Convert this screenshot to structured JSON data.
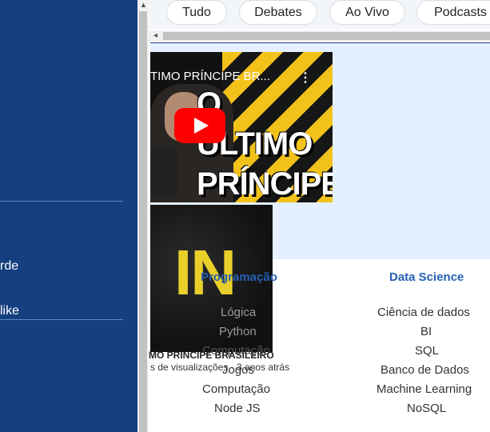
{
  "sidebar": {
    "items": [
      {
        "label": "rde"
      },
      {
        "label": "like"
      }
    ]
  },
  "chips": [
    {
      "label": "Tudo"
    },
    {
      "label": "Debates"
    },
    {
      "label": "Ao Vivo"
    },
    {
      "label": "Podcasts"
    }
  ],
  "video": {
    "title": "TIMO PRÍNCIPE BR...",
    "thumbnail_text_line1": "O ÚLTIMO",
    "thumbnail_text_line2": "PRÍNCIPE"
  },
  "second_video": {
    "thumbnail_text": "IN",
    "title": "MO PRÍNCIPE BRASILEIRO",
    "meta": "s de visualizações · 3 anos atrás"
  },
  "links": {
    "programacao": {
      "heading": "Programação",
      "items": [
        "Lógica",
        "Python",
        "Computação",
        "Jogos",
        "Computação",
        "Node JS"
      ]
    },
    "data_science": {
      "heading": "Data Science",
      "items": [
        "Ciência de dados",
        "BI",
        "SQL",
        "Banco de Dados",
        "Machine Learning",
        "NoSQL"
      ]
    }
  },
  "colors": {
    "sidebar": "#153f7e",
    "accent_link": "#2561b4",
    "panel": "#e4efff",
    "play_button": "#ff0000"
  }
}
